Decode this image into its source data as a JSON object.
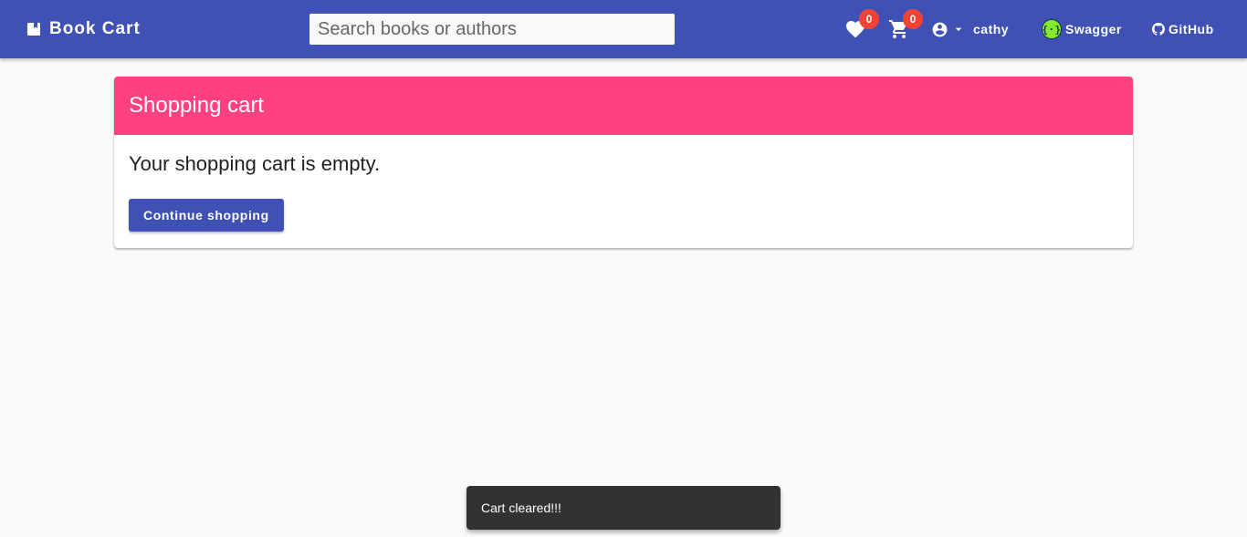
{
  "header": {
    "brand_label": "Book Cart",
    "search_placeholder": "Search books or authors",
    "wishlist_count": "0",
    "cart_count": "0",
    "user_name": "cathy",
    "swagger_label": "Swagger",
    "github_label": "GitHub",
    "icons": {
      "brand": "book-icon",
      "wishlist": "heart-icon",
      "cart": "cart-icon",
      "user": "account-circle-icon",
      "user_dropdown": "caret-down-icon",
      "swagger": "swagger-icon",
      "github": "github-icon"
    }
  },
  "cart": {
    "title": "Shopping cart",
    "empty_message": "Your shopping cart is empty.",
    "continue_label": "Continue shopping"
  },
  "snackbar": {
    "message": "Cart cleared!!!"
  },
  "colors": {
    "primary": "#3f51b5",
    "accent": "#ff4081",
    "badge": "#f44336",
    "snackbar": "#323232",
    "swagger": "#85ea2d"
  }
}
